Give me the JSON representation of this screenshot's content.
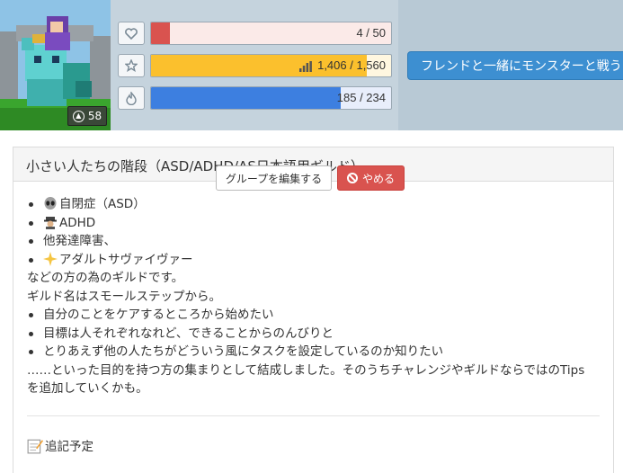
{
  "header": {
    "level": "58",
    "stats": [
      {
        "name": "health",
        "icon": "heart-icon",
        "value": "4 / 50",
        "fraction": 0.08,
        "color": "#d9534f"
      },
      {
        "name": "experience",
        "icon": "star-icon",
        "value": "1,406 / 1,560",
        "fraction": 0.9,
        "color": "#fbc02d"
      },
      {
        "name": "mana",
        "icon": "flame-icon",
        "value": "185 / 234",
        "fraction": 0.79,
        "color": "#3d7fe0"
      }
    ],
    "friend_button": "フレンドと一緒にモンスターと戦う"
  },
  "guild": {
    "title": "小さい人たちの階段（ASD/ADHD/AS日本語用ギルド）",
    "edit_button": "グループを編集する",
    "quit_button": "やめる",
    "list1": [
      {
        "emoji": "alien-icon",
        "text": "自閉症（ASD）"
      },
      {
        "emoji": "detective-icon",
        "text": "ADHD"
      },
      {
        "emoji": "",
        "text": "他発達障害、"
      },
      {
        "emoji": "sparkle-icon",
        "text": "アダルトサヴァイヴァー"
      }
    ],
    "para1": "などの方の為のギルドです。",
    "para2": "ギルド名はスモールステップから。",
    "list2": [
      "自分のことをケアするところから始めたい",
      "目標は人それぞれなれど、できることからのんびりと",
      "とりあえず他の人たちがどういう風にタスクを設定しているのか知りたい"
    ],
    "para3": "……といった目的を持つ方の集まりとして結成しました。そのうちチャレンジやギルドならではのTips",
    "para4": "を追加していくかも。",
    "footer_note": "追記予定"
  }
}
